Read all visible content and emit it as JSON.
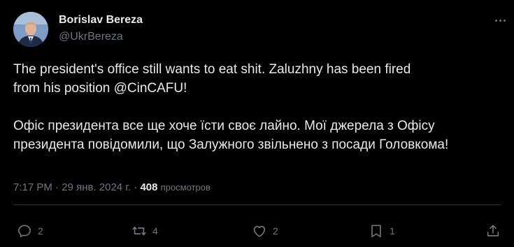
{
  "author": {
    "display_name": "Borislav Bereza",
    "handle": "@UkrBereza"
  },
  "post": {
    "text_en": "The president's office still wants to eat shit.  Zaluzhny has been fired\nfrom his position @CinCAFU!",
    "text_uk": "Офіс президента все ще хоче їсти своє лайно. Мої джерела з Офісу\nпрезидента повідомили, що Залужного звільнено з посади Головкома!"
  },
  "meta": {
    "time": "7:17 PM",
    "sep1": "·",
    "date": "29 янв. 2024 г.",
    "sep2": "·",
    "views_count": "408",
    "views_label": "просмотров"
  },
  "actions": {
    "reply_count": "2",
    "repost_count": "4",
    "like_count": "2",
    "bookmark_count": "1"
  },
  "icons": {
    "reply": "reply-icon",
    "repost": "repost-icon",
    "like": "heart-icon",
    "bookmark": "bookmark-icon",
    "share": "share-icon",
    "more": "more-icon"
  },
  "colors": {
    "background": "#000000",
    "text": "#e7e9ea",
    "secondary": "#71767b",
    "divider": "#2f3336"
  }
}
